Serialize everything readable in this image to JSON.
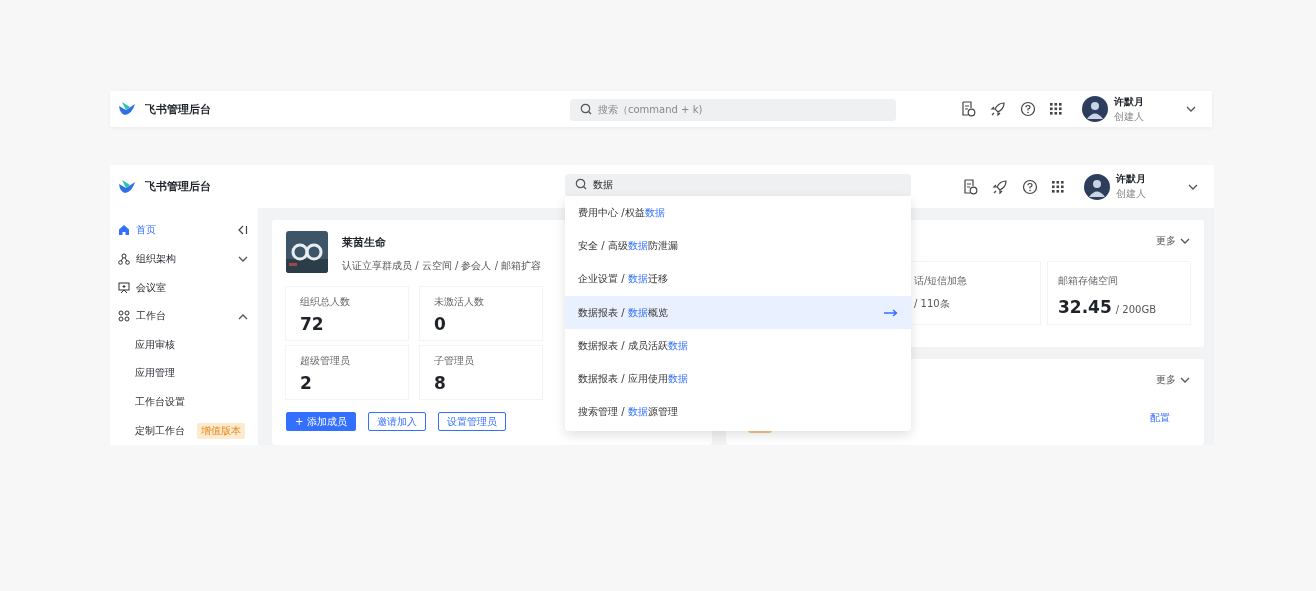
{
  "top_bar": {
    "app_title": "飞书管理后台",
    "search": {
      "placeholder": "搜索（command + k)"
    },
    "user": {
      "name": "许默月",
      "role": "创建人"
    }
  },
  "main": {
    "header": {
      "app_title": "飞书管理后台",
      "search": {
        "value": "数据"
      },
      "user": {
        "name": "许默月",
        "role": "创建人"
      }
    },
    "sidebar": {
      "items": [
        {
          "label": "首页",
          "selected": true
        },
        {
          "label": "组织架构",
          "selected": false,
          "expanded": false
        },
        {
          "label": "会议室",
          "selected": false
        },
        {
          "label": "工作台",
          "selected": false,
          "expanded": true,
          "children": [
            {
              "label": "应用审核",
              "selected": false
            },
            {
              "label": "应用管理",
              "selected": false
            },
            {
              "label": "工作台设置",
              "selected": false
            },
            {
              "label": "定制工作台",
              "selected": false,
              "badge": "增值版本"
            }
          ]
        }
      ]
    },
    "org_card": {
      "name": "莱茵生命",
      "tags": "认证立享群成员 / 云空间 / 参会人 / 邮箱扩容",
      "stats": [
        {
          "label": "组织总人数",
          "value": "72"
        },
        {
          "label": "未激活人数",
          "value": "0"
        },
        {
          "label": "超级管理员",
          "value": "2"
        },
        {
          "label": "子管理员",
          "value": "8"
        }
      ],
      "buttons": [
        {
          "label": "+ 添加成员",
          "kind": "primary"
        },
        {
          "label": "邀请加入",
          "kind": "outline"
        },
        {
          "label": "设置管理员",
          "kind": "outline"
        }
      ]
    },
    "resource_card": {
      "more": "更多",
      "stats": [
        {
          "label": "话/短信加急",
          "total": "/ 110条"
        },
        {
          "label": "邮箱存储空间",
          "value": "32.45",
          "total": "/ 200GB"
        }
      ]
    },
    "second_card": {
      "more": "更多",
      "link": "配置"
    },
    "search_results": [
      {
        "selected": false,
        "segments": [
          {
            "text": "费用中心 /权益",
            "highlight": false
          },
          {
            "text": "数据",
            "highlight": true
          }
        ]
      },
      {
        "selected": false,
        "segments": [
          {
            "text": "安全 / 高级",
            "highlight": false
          },
          {
            "text": "数据",
            "highlight": true
          },
          {
            "text": "防泄漏",
            "highlight": false
          }
        ]
      },
      {
        "selected": false,
        "segments": [
          {
            "text": "企业设置 / ",
            "highlight": false
          },
          {
            "text": "数据",
            "highlight": true
          },
          {
            "text": "迁移",
            "highlight": false
          }
        ]
      },
      {
        "selected": true,
        "segments": [
          {
            "text": "数据报表 / ",
            "highlight": false
          },
          {
            "text": "数据",
            "highlight": true
          },
          {
            "text": "概览",
            "highlight": false
          }
        ]
      },
      {
        "selected": false,
        "segments": [
          {
            "text": "数据报表 / 成员活跃",
            "highlight": false
          },
          {
            "text": "数据",
            "highlight": true
          }
        ]
      },
      {
        "selected": false,
        "segments": [
          {
            "text": "数据报表 / 应用使用",
            "highlight": false
          },
          {
            "text": "数据",
            "highlight": true
          }
        ]
      },
      {
        "selected": false,
        "segments": [
          {
            "text": "搜索管理 / ",
            "highlight": false
          },
          {
            "text": "数据",
            "highlight": true
          },
          {
            "text": "源管理",
            "highlight": false
          }
        ]
      }
    ]
  }
}
